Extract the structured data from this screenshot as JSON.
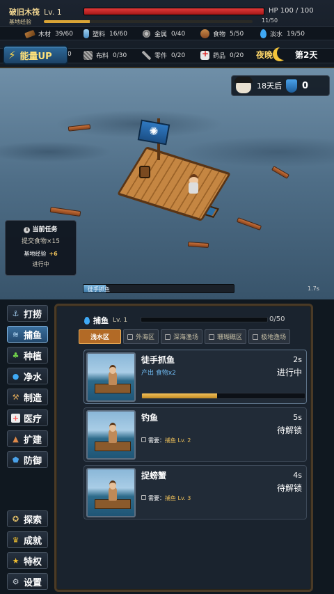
{
  "hud": {
    "title": "破旧木筏",
    "level": "Lv. 1",
    "hp_text": "HP 100 / 100",
    "hp_fraction": 1.0,
    "base_exp_label": "基地经验",
    "base_exp_text": "11/50",
    "base_exp_fraction": 0.22
  },
  "resources_row1": [
    {
      "name": "木材",
      "value": "39/60",
      "icon": "wood-icon"
    },
    {
      "name": "塑料",
      "value": "16/60",
      "icon": "plastic-icon"
    },
    {
      "name": "金属",
      "value": "0/40",
      "icon": "metal-icon"
    },
    {
      "name": "食物",
      "value": "5/50",
      "icon": "food-icon"
    },
    {
      "name": "淡水",
      "value": "19/50",
      "icon": "water-icon"
    }
  ],
  "resources_row2": [
    {
      "name": "",
      "value": "0",
      "icon": "hidden"
    },
    {
      "name": "布料",
      "value": "0/30",
      "icon": "cloth-icon"
    },
    {
      "name": "零件",
      "value": "0/20",
      "icon": "parts-icon"
    },
    {
      "name": "药品",
      "value": "0/20",
      "icon": "medicine-icon"
    }
  ],
  "energy_button": "能量UP",
  "time": {
    "period": "夜晚",
    "day": "第2天"
  },
  "raid": {
    "text": "18天后",
    "defense": "0"
  },
  "task": {
    "header": "当前任务",
    "desc": "提交食物×15",
    "reward_label": "基地经验",
    "reward_value": "+6",
    "status": "进行中"
  },
  "progress": {
    "label": "徒手抓鱼",
    "time": "1.7s",
    "fraction": 0.15
  },
  "sidebar": [
    {
      "label": "打捞",
      "icon": "anchor-icon",
      "glyph": "⚓"
    },
    {
      "label": "捕鱼",
      "icon": "fish-icon",
      "glyph": "🐟"
    },
    {
      "label": "种植",
      "icon": "sprout-icon",
      "glyph": "🌱"
    },
    {
      "label": "净水",
      "icon": "water-drop-icon",
      "glyph": "💧"
    },
    {
      "label": "制造",
      "icon": "hammer-icon",
      "glyph": "🔨"
    },
    {
      "label": "医疗",
      "icon": "medkit-icon",
      "glyph": "✚"
    },
    {
      "label": "扩建",
      "icon": "build-icon",
      "glyph": "⛩"
    },
    {
      "label": "防御",
      "icon": "shield-icon",
      "glyph": "🛡"
    }
  ],
  "sidebar_bottom": [
    {
      "label": "探索",
      "icon": "compass-icon",
      "glyph": "✪"
    },
    {
      "label": "成就",
      "icon": "trophy-icon",
      "glyph": "🏆"
    },
    {
      "label": "特权",
      "icon": "star-icon",
      "glyph": "★"
    },
    {
      "label": "设置",
      "icon": "gear-icon",
      "glyph": "⚙"
    }
  ],
  "panel": {
    "skill_name": "捕鱼",
    "skill_level": "Lv. 1",
    "skill_exp": "0/50",
    "tabs": [
      {
        "label": "浅水区",
        "locked": false
      },
      {
        "label": "外海区",
        "locked": true
      },
      {
        "label": "深海渔场",
        "locked": true
      },
      {
        "label": "珊瑚礁区",
        "locked": true
      },
      {
        "label": "极地渔场",
        "locked": true
      }
    ],
    "cards": [
      {
        "name": "徒手抓鱼",
        "time": "2s",
        "status": "进行中",
        "sub": "产出 食物x2",
        "progress": 0.46
      },
      {
        "name": "钓鱼",
        "time": "5s",
        "status": "待解锁",
        "req_label": "需要：",
        "req_value": "捕鱼 Lv. 2"
      },
      {
        "name": "捉螃蟹",
        "time": "4s",
        "status": "待解锁",
        "req_label": "需要：",
        "req_value": "捕鱼 Lv. 3"
      }
    ]
  }
}
